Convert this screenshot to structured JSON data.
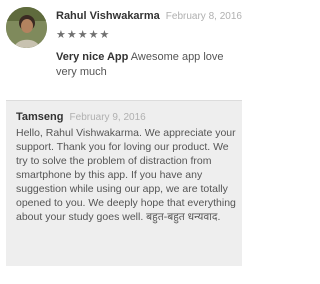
{
  "review": {
    "author": "Rahul Vishwakarma",
    "date": "February 8, 2016",
    "rating": 5,
    "title": "Very nice App",
    "text": "Awesome app love very much"
  },
  "reply": {
    "author": "Tamseng",
    "date": "February 9, 2016",
    "text": "Hello, Rahul Vishwakarma. We appreciate your support. Thank you for loving our product. We try to solve the problem of distraction from smartphone by this app. If you have any suggestion while using our app, we are totally opened to you. We deeply hope that everything about your study goes well. बहुत-बहुत धन्यवाद."
  }
}
